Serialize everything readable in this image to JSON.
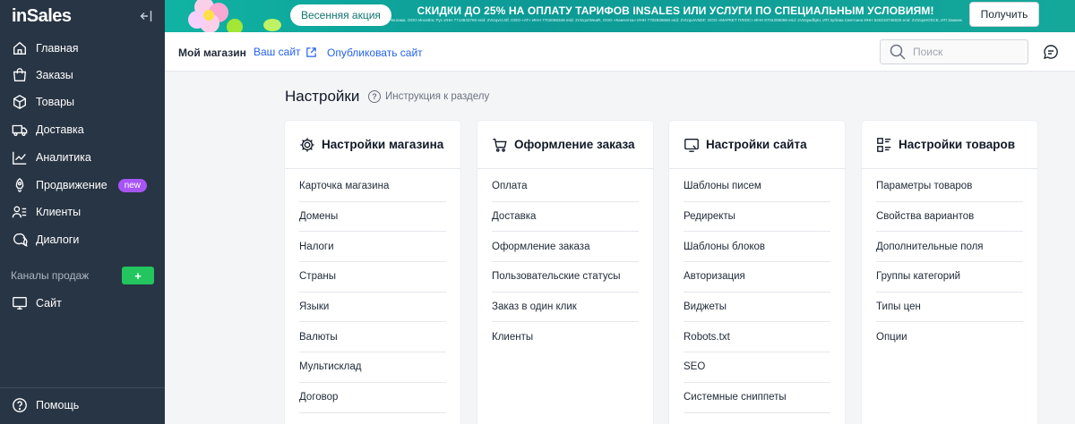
{
  "sidebar": {
    "logo": "inSales",
    "items": [
      {
        "label": "Главная",
        "icon": "home-icon"
      },
      {
        "label": "Заказы",
        "icon": "orders-bag-icon"
      },
      {
        "label": "Товары",
        "icon": "products-box-icon"
      },
      {
        "label": "Доставка",
        "icon": "delivery-truck-icon"
      },
      {
        "label": "Аналитика",
        "icon": "analytics-chart-icon"
      },
      {
        "label": "Продвижение",
        "icon": "promotion-rocket-icon",
        "badge": "new"
      },
      {
        "label": "Клиенты",
        "icon": "clients-icon"
      },
      {
        "label": "Диалоги",
        "icon": "dialogs-icon"
      }
    ],
    "channels_label": "Каналы продаж",
    "channels_add": "+",
    "site_item": {
      "label": "Сайт",
      "icon": "monitor-icon"
    },
    "help_item": {
      "label": "Помощь",
      "icon": "help-icon"
    }
  },
  "banner": {
    "spring_label": "Весенняя акция",
    "title": "СКИДКИ ДО 25% НА ОПЛАТУ ТАРИФОВ INSALES ИЛИ УСЛУГИ ПО СПЕЦИАЛЬНЫМ УСЛОВИЯМ!",
    "fine_print": "Реклама. ООО Инсейлс Рус ИНН 7714843760 erid: 2VtzqvrzJ3f, ООО «АТ» ИНН 7702066348 erid: 2VtzqvrWeaR, ООО «Камчатка» ИНН 7702835660 erid: 2VtzqvsV5DF, ООО «МАРКЕТ ПЛЮС» ИНН 9704206059 erid: 2VtzqwdhjKr, ИП Зубова Светлана ИНН 540210746025 erid: 2VtzqxHGhCE, ИП Заикина Татьяна ИНН 540203935668 erid: 2VtzqvXb2qj, ИП Мударов Эмиль ИНН 7705478541 erid: 2VtzqvrZpHx",
    "get_label": "Получить",
    "colors": {
      "bg": "#10b3a3",
      "accent": "#f0abfc"
    }
  },
  "topbar": {
    "shop_name": "Мой магазин",
    "site_link": "Ваш сайт",
    "publish_link": "Опубликовать сайт",
    "search_placeholder": "Поиск"
  },
  "main": {
    "title": "Настройки",
    "instruction": "Инструкция к разделу",
    "cards": [
      {
        "title": "Настройки магазина",
        "icon": "gear-icon",
        "items": [
          "Карточка магазина",
          "Домены",
          "Налоги",
          "Страны",
          "Языки",
          "Валюты",
          "Мультисклад",
          "Договор"
        ]
      },
      {
        "title": "Оформление заказа",
        "icon": "cart-icon",
        "items": [
          "Оплата",
          "Доставка",
          "Оформление заказа",
          "Пользовательские статусы",
          "Заказ в один клик",
          "Клиенты"
        ]
      },
      {
        "title": "Настройки сайта",
        "icon": "site-monitor-icon",
        "items": [
          "Шаблоны писем",
          "Редиректы",
          "Шаблоны блоков",
          "Авторизация",
          "Виджеты",
          "Robots.txt",
          "SEO",
          "Системные сниппеты"
        ]
      },
      {
        "title": "Настройки товаров",
        "icon": "product-grid-icon",
        "items": [
          "Параметры товаров",
          "Свойства вариантов",
          "Дополнительные поля",
          "Группы категорий",
          "Типы цен",
          "Опции"
        ]
      }
    ]
  },
  "colors": {
    "sidebar": "#283544",
    "link": "#2563eb",
    "badge": "#a855f7",
    "add": "#22c55e"
  }
}
